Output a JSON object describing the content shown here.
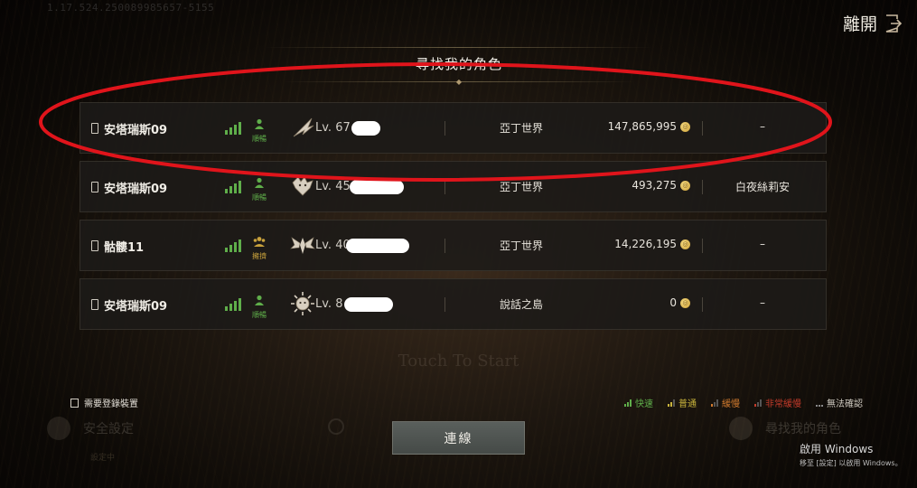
{
  "version_text": "1.17.524.250089985657-5155",
  "exit": {
    "label": "離開",
    "icon": "exit-door-icon"
  },
  "title": "尋找我的角色",
  "characters": [
    {
      "name": "安塔瑞斯09",
      "signal": "fast",
      "status": "順暢",
      "status_icon": "person-icon",
      "class_icon": "feather-wing-icon",
      "level": "Lv. 67",
      "server": "亞丁世界",
      "adena": "147,865,995",
      "extra": "–"
    },
    {
      "name": "安塔瑞斯09",
      "signal": "fast",
      "status": "順暢",
      "status_icon": "person-icon",
      "class_icon": "wolf-head-icon",
      "level": "Lv. 45",
      "server": "亞丁世界",
      "adena": "493,275",
      "extra": "白夜絲莉安"
    },
    {
      "name": "骷髏11",
      "signal": "fast",
      "status": "擁擠",
      "status_icon": "crowd-icon",
      "class_icon": "winged-emblem-icon",
      "level": "Lv. 40",
      "server": "亞丁世界",
      "adena": "14,226,195",
      "extra": "–"
    },
    {
      "name": "安塔瑞斯09",
      "signal": "fast",
      "status": "順暢",
      "status_icon": "person-icon",
      "class_icon": "sun-mask-icon",
      "level": "Lv. 8",
      "server": "說話之島",
      "adena": "0",
      "extra": "–"
    }
  ],
  "background_text": "Touch To Start",
  "need_device": {
    "label": "需要登錄裝置",
    "checked": false
  },
  "legend": [
    {
      "label": "快速",
      "color": "#5fae4a"
    },
    {
      "label": "普通",
      "color": "#c9b43c"
    },
    {
      "label": "緩慢",
      "color": "#d07a2e"
    },
    {
      "label": "非常緩慢",
      "color": "#c23a2a"
    },
    {
      "label": "無法確認",
      "color": "#8a8a8a"
    }
  ],
  "security": {
    "label": "安全設定",
    "sub": "設定中"
  },
  "find_char_bg": "尋找我的角色",
  "connect_label": "連線",
  "windows_activation": {
    "title": "啟用 Windows",
    "sub": "移至 [設定] 以啟用 Windows。"
  },
  "colors": {
    "signal_green": "#5fae4a",
    "annotation_red": "#e0141b",
    "button_bg": "#4f5451"
  }
}
